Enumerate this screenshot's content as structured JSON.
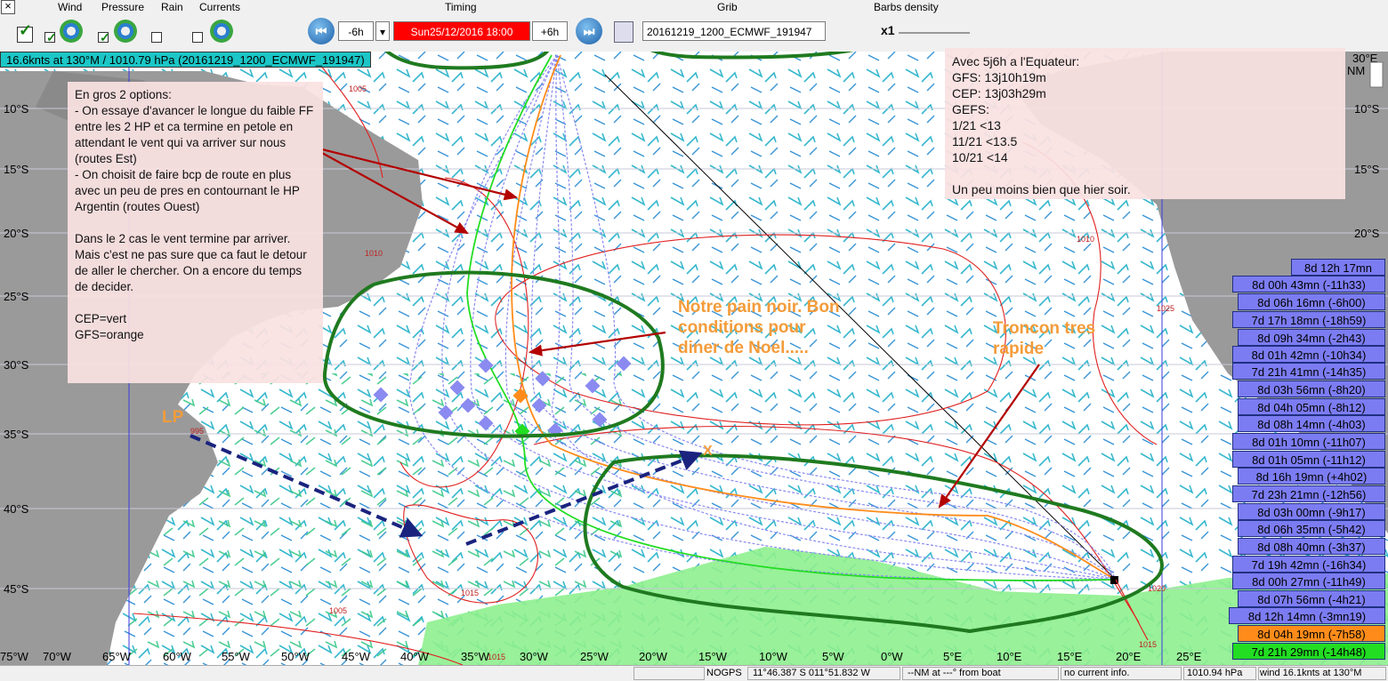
{
  "toolbar": {
    "close_glyph": "×",
    "wind_label": "Wind",
    "pressure_label": "Pressure",
    "rain_label": "Rain",
    "currents_label": "Currents",
    "timing_label": "Timing",
    "grib_label": "Grib",
    "barbs_label": "Barbs density",
    "step_back": "-6h",
    "date": "Sun25/12/2016 18:00",
    "step_fwd": "+6h",
    "grib_file": "20161219_1200_ECMWF_191947",
    "barbs_value": "x1",
    "wind_checked": true,
    "pressure_checked": true,
    "rain_checked": false,
    "currents_checked": false
  },
  "info_bar": "16.6knts at 130°M / 1010.79 hPa (20161219_1200_ECMWF_191947)",
  "map": {
    "lon_labels": [
      "75°W",
      "70°W",
      "65°W",
      "60°W",
      "55°W",
      "50°W",
      "45°W",
      "40°W",
      "35°W",
      "30°W",
      "25°W",
      "20°W",
      "15°W",
      "10°W",
      "5°W",
      "0°W",
      "5°E",
      "10°E",
      "15°E",
      "20°E",
      "25°E",
      "30°E"
    ],
    "lat_labels": [
      "10°S",
      "15°S",
      "20°S",
      "25°S",
      "30°S",
      "35°S",
      "40°S",
      "45°S"
    ],
    "isobars": [
      "1005",
      "1010",
      "1015",
      "1020",
      "995",
      "1005",
      "1010",
      "1015",
      "1025",
      "1015"
    ],
    "nm_label": "NM"
  },
  "notes": {
    "left": "En gros 2 options:\n- On essaye d'avancer le longue du faible FF entre les 2 HP et ca termine en petole en attendant le vent qui va arriver sur nous (routes Est)\n- On choisit de faire bcp de route en plus avec un peu de pres en contournant le HP Argentin (routes Ouest)\n\nDans le 2 cas le vent termine par arriver. Mais c'est ne pas sure que ca faut le detour de aller le chercher. On a encore du temps de decider.\n\nCEP=vert\nGFS=orange",
    "right": "Avec 5j6h a l'Equateur:\nGFS: 13j10h19m\nCEP: 13j03h29m\nGEFS:\n1/21 <13\n11/21 <13.5\n10/21 <14\n\nUn peu moins bien que hier soir.",
    "noel": "Notre pain noir. Bon\nconditions pour\ndiner de Noel.....",
    "troncon": "Troncon tres\nrapide",
    "lp": "LP",
    "x": "X"
  },
  "eta_list": [
    {
      "text": "8d 12h 17mn",
      "kind": "blue"
    },
    {
      "text": "8d 00h 43mn (-11h33)",
      "kind": "blue"
    },
    {
      "text": "8d 06h 16mn (-6h00)",
      "kind": "blue"
    },
    {
      "text": "7d 17h 18mn (-18h59)",
      "kind": "blue"
    },
    {
      "text": "8d 09h 34mn (-2h43)",
      "kind": "blue"
    },
    {
      "text": "8d 01h 42mn (-10h34)",
      "kind": "blue"
    },
    {
      "text": "7d 21h 41mn (-14h35)",
      "kind": "blue"
    },
    {
      "text": "8d 03h 56mn (-8h20)",
      "kind": "blue"
    },
    {
      "text": "8d 04h 05mn (-8h12)",
      "kind": "blue"
    },
    {
      "text": "8d 08h 14mn (-4h03)",
      "kind": "blue"
    },
    {
      "text": "8d 01h 10mn (-11h07)",
      "kind": "blue"
    },
    {
      "text": "8d 01h 05mn (-11h12)",
      "kind": "blue"
    },
    {
      "text": "8d 16h 19mn (+4h02)",
      "kind": "blue"
    },
    {
      "text": "7d 23h 21mn (-12h56)",
      "kind": "blue"
    },
    {
      "text": "8d 03h 00mn (-9h17)",
      "kind": "blue"
    },
    {
      "text": "8d 06h 35mn (-5h42)",
      "kind": "blue"
    },
    {
      "text": "8d 08h 40mn (-3h37)",
      "kind": "blue"
    },
    {
      "text": "7d 19h 42mn (-16h34)",
      "kind": "blue"
    },
    {
      "text": "8d 00h 27mn (-11h49)",
      "kind": "blue"
    },
    {
      "text": "8d 07h 56mn (-4h21)",
      "kind": "blue"
    },
    {
      "text": "8d 12h 14mn (-3mn19)",
      "kind": "blue"
    },
    {
      "text": "8d 04h 19mn (-7h58)",
      "kind": "orange"
    },
    {
      "text": "7d 21h 29mn (-14h48)",
      "kind": "green"
    }
  ],
  "colors": {
    "blue": "#7c7cf2",
    "orange": "#ff8c1a",
    "green": "#22dd22"
  },
  "status": {
    "gps": "NOGPS",
    "position": "11°46.387 S  011°51.832 W",
    "distance": "--NM at ---° from boat",
    "current": "no current info.",
    "pressure": "1010.94 hPa",
    "wind": "wind 16.1knts at 130°M"
  }
}
